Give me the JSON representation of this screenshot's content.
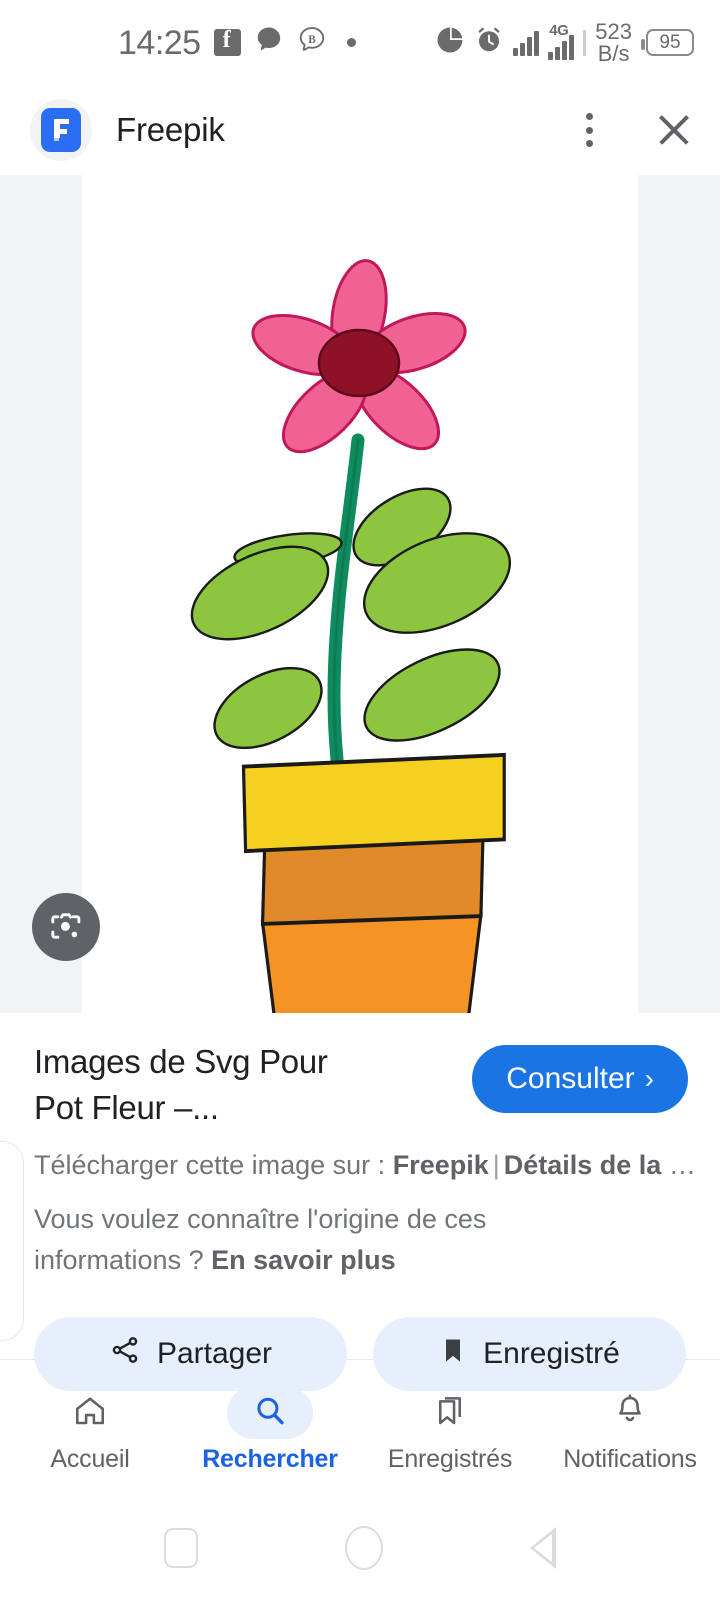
{
  "status_bar": {
    "time": "14:25",
    "icons_left": [
      "facebook-icon",
      "message-bubble-icon",
      "bip-b-icon",
      "dot-icon"
    ],
    "icons_right": [
      "data-usage-pie-icon",
      "alarm-clock-icon",
      "signal-bars-icon",
      "signal-4g-icon"
    ],
    "network_type": "4G",
    "net_speed_value": "523",
    "net_speed_unit": "B/s",
    "battery_level": "95"
  },
  "header": {
    "app_name": "Freepik",
    "logo_letter": "F",
    "menu_icon": "kebab-menu-icon",
    "close_icon": "close-icon"
  },
  "viewer": {
    "lens_icon": "google-lens-icon",
    "artwork": {
      "alt": "Pot de fleur avec fleur rose",
      "flower_petal_color": "#F06292",
      "flower_petal_stroke": "#C2185B",
      "flower_center_color": "#8E1128",
      "stem_color": "#0E8C5E",
      "leaf_color": "#8CC63F",
      "pot_rim_color": "#F5D020",
      "pot_band_color": "#E08A2A",
      "pot_body_color": "#F59425",
      "outline_color": "#1a1a1a"
    }
  },
  "result": {
    "title": "Images de Svg Pour Pot Fleur –...",
    "consult_label": "Consulter",
    "consult_chevron": "›",
    "source_prefix": "Télécharger cette image sur :",
    "source_name": "Freepik",
    "source_separator": "|",
    "source_details": "Détails de la",
    "source_ellipsis": "…",
    "origin_question": "Vous voulez connaître l'origine de ces informations ?",
    "origin_link": "En savoir plus"
  },
  "actions": [
    {
      "label": "Partager",
      "icon": "share-icon"
    },
    {
      "label": "Enregistré",
      "icon": "bookmark-filled-icon"
    }
  ],
  "bottom_nav": {
    "active_index": 1,
    "items": [
      {
        "label": "Accueil",
        "icon": "home-icon"
      },
      {
        "label": "Rechercher",
        "icon": "search-icon"
      },
      {
        "label": "Enregistrés",
        "icon": "bookmarks-icon"
      },
      {
        "label": "Notifications",
        "icon": "bell-icon"
      }
    ]
  },
  "android_nav": {
    "recents_icon": "square-recents-icon",
    "home_icon": "circle-home-icon",
    "back_icon": "triangle-back-icon"
  },
  "colors": {
    "accent_blue": "#1b74e4",
    "chip_bg": "#e8effc",
    "viewer_bg": "#f1f3f4",
    "text_primary": "#202124",
    "text_secondary": "#70757a"
  }
}
